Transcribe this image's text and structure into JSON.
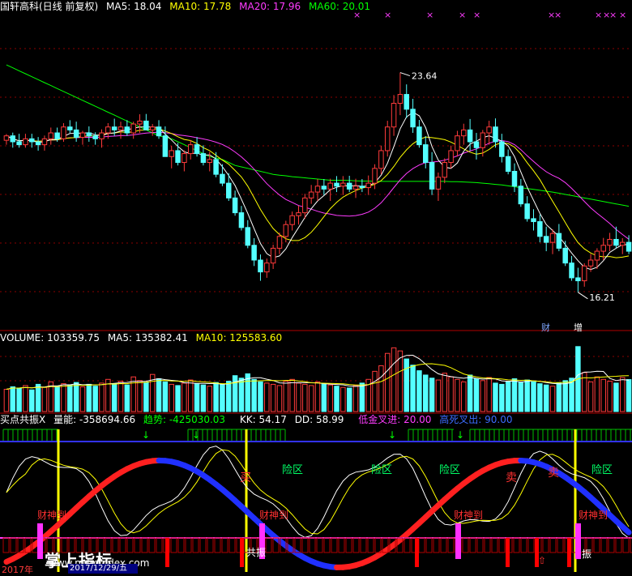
{
  "colors": {
    "up": "#ff3b3b",
    "down": "#54ffff",
    "ma5": "#ffffff",
    "ma10": "#ffff00",
    "ma20": "#ff3cff",
    "ma60": "#00ff00",
    "grid": "#8b0000",
    "blue_line": "#3232ff"
  },
  "header": {
    "stock": "国轩高科(日线 前复权)",
    "ma5": "MA5: 18.04",
    "ma10": "MA10: 17.78",
    "ma20": "MA20: 17.96",
    "ma60": "MA60: 20.01"
  },
  "volume_header": {
    "label": "VOLUME: 103359.75",
    "ma5": "MA5: 135382.41",
    "ma10": "MA10: 125583.60"
  },
  "indicator_header": {
    "name": "买点共振X",
    "liangneng": "量能: -358694.66",
    "qushi": "趋势: -425030.03",
    "kk": "KK: 54.17",
    "dd": "DD: 58.99",
    "dijin": "低金叉进: 20.00",
    "gaosi": "高死叉出: 90.00"
  },
  "price_labels": {
    "high": "23.64",
    "low": "16.21",
    "cai": "财",
    "zeng": "增"
  },
  "annotations": {
    "danger": "险区",
    "danger2": "险区",
    "danger3": "险区",
    "danger4": "险区",
    "caishen": "财神到",
    "buy": "买",
    "sell": "卖",
    "gongzhen": "共振",
    "zhen": "振",
    "buy_arrow": "⇧"
  },
  "watermark": "掌上指标",
  "watermark_url": "www.palmindex.com",
  "bottom": {
    "year": "2017年",
    "date": "2017/12/29/五"
  },
  "chart_data": [
    {
      "type": "candlestick",
      "title": "国轩高科(日线 前复权)",
      "ylim": [
        15.0,
        25.6
      ],
      "annotated_high": 23.64,
      "annotated_low": 16.21,
      "candles": [
        [
          21.35,
          21.56,
          21.2,
          21.5
        ],
        [
          21.5,
          21.61,
          21.1,
          21.3
        ],
        [
          21.3,
          21.57,
          21.1,
          21.2
        ],
        [
          21.2,
          21.57,
          21.1,
          21.4
        ],
        [
          21.4,
          21.57,
          21.1,
          21.3
        ],
        [
          21.3,
          21.46,
          21.0,
          21.2
        ],
        [
          21.2,
          21.51,
          21.0,
          21.4
        ],
        [
          21.4,
          21.78,
          21.2,
          21.6
        ],
        [
          21.6,
          21.78,
          21.3,
          21.4
        ],
        [
          21.4,
          21.93,
          21.3,
          21.8
        ],
        [
          21.8,
          22.03,
          21.6,
          21.7
        ],
        [
          21.7,
          21.98,
          21.3,
          21.45
        ],
        [
          21.45,
          21.67,
          21.2,
          21.6
        ],
        [
          21.6,
          21.82,
          21.3,
          21.5
        ],
        [
          21.5,
          21.62,
          21.2,
          21.4
        ],
        [
          21.4,
          21.72,
          21.1,
          21.6
        ],
        [
          21.6,
          21.93,
          21.4,
          21.8
        ],
        [
          21.8,
          22.08,
          21.5,
          21.7
        ],
        [
          21.7,
          21.98,
          21.4,
          21.8
        ],
        [
          21.8,
          22.03,
          21.5,
          21.6
        ],
        [
          21.6,
          21.98,
          21.4,
          21.9
        ],
        [
          21.9,
          22.23,
          21.6,
          22.0
        ],
        [
          22.0,
          22.24,
          21.7,
          21.7
        ],
        [
          21.7,
          21.9,
          21.5,
          21.8
        ],
        [
          21.8,
          22.03,
          21.4,
          21.5
        ],
        [
          21.5,
          21.82,
          21.0,
          20.8
        ],
        [
          20.8,
          21.16,
          20.4,
          21.0
        ],
        [
          21.0,
          21.26,
          20.5,
          20.6
        ],
        [
          20.6,
          21.01,
          20.3,
          20.9
        ],
        [
          20.9,
          21.36,
          20.7,
          21.2
        ],
        [
          21.2,
          21.46,
          20.8,
          20.9
        ],
        [
          20.9,
          21.18,
          20.5,
          20.6
        ],
        [
          20.6,
          20.96,
          20.3,
          20.7
        ],
        [
          20.7,
          20.95,
          20.1,
          20.2
        ],
        [
          20.2,
          20.54,
          19.8,
          19.9
        ],
        [
          19.9,
          20.24,
          19.3,
          19.4
        ],
        [
          19.4,
          19.65,
          18.8,
          18.9
        ],
        [
          18.9,
          19.13,
          18.3,
          18.4
        ],
        [
          18.4,
          18.65,
          17.7,
          17.8
        ],
        [
          17.8,
          18.04,
          17.1,
          17.3
        ],
        [
          17.3,
          17.49,
          16.6,
          16.9
        ],
        [
          16.9,
          17.35,
          16.7,
          17.2
        ],
        [
          17.2,
          17.82,
          17.0,
          17.7
        ],
        [
          17.7,
          18.23,
          17.5,
          18.1
        ],
        [
          18.1,
          18.63,
          17.9,
          18.5
        ],
        [
          18.5,
          18.94,
          18.3,
          18.8
        ],
        [
          18.8,
          19.14,
          18.5,
          18.9
        ],
        [
          18.9,
          19.54,
          18.7,
          19.4
        ],
        [
          19.4,
          19.84,
          19.2,
          19.6
        ],
        [
          19.6,
          20.04,
          19.3,
          19.8
        ],
        [
          19.8,
          20.04,
          19.5,
          19.7
        ],
        [
          19.7,
          20.05,
          19.3,
          19.9
        ],
        [
          19.9,
          20.14,
          19.6,
          19.8
        ],
        [
          19.8,
          20.14,
          19.5,
          19.9
        ],
        [
          19.9,
          20.15,
          19.6,
          19.7
        ],
        [
          19.7,
          20.05,
          19.4,
          19.8
        ],
        [
          19.8,
          20.04,
          19.6,
          19.75
        ],
        [
          19.75,
          20.16,
          19.5,
          19.9
        ],
        [
          19.9,
          20.54,
          19.7,
          20.4
        ],
        [
          20.4,
          21.17,
          20.2,
          21.0
        ],
        [
          21.0,
          22.01,
          20.8,
          21.8
        ],
        [
          21.8,
          22.88,
          21.5,
          22.6
        ],
        [
          22.6,
          23.64,
          22.2,
          22.9
        ],
        [
          22.9,
          23.24,
          22.1,
          22.4
        ],
        [
          22.4,
          22.75,
          21.6,
          21.8
        ],
        [
          21.8,
          22.04,
          21.1,
          21.2
        ],
        [
          21.2,
          21.49,
          20.4,
          20.6
        ],
        [
          20.6,
          20.95,
          19.5,
          19.7
        ],
        [
          19.7,
          20.26,
          19.3,
          20.1
        ],
        [
          20.1,
          20.74,
          19.9,
          20.6
        ],
        [
          20.6,
          21.17,
          20.4,
          21.0
        ],
        [
          21.0,
          21.67,
          20.8,
          21.5
        ],
        [
          21.5,
          21.91,
          21.2,
          21.7
        ],
        [
          21.7,
          22.07,
          21.0,
          21.3
        ],
        [
          21.3,
          21.6,
          20.7,
          21.1
        ],
        [
          21.1,
          21.7,
          20.8,
          21.6
        ],
        [
          21.6,
          22.01,
          21.2,
          21.8
        ],
        [
          21.8,
          22.09,
          21.1,
          21.3
        ],
        [
          21.3,
          21.57,
          20.6,
          20.8
        ],
        [
          20.8,
          21.04,
          20.2,
          20.3
        ],
        [
          20.3,
          20.57,
          19.6,
          19.8
        ],
        [
          19.8,
          20.04,
          19.1,
          19.2
        ],
        [
          19.2,
          19.46,
          18.6,
          18.7
        ],
        [
          18.7,
          19.02,
          18.3,
          18.6
        ],
        [
          18.6,
          18.84,
          17.9,
          18.1
        ],
        [
          18.1,
          18.43,
          17.6,
          17.9
        ],
        [
          17.9,
          18.34,
          17.5,
          18.2
        ],
        [
          18.2,
          18.52,
          17.6,
          17.7
        ],
        [
          17.7,
          17.95,
          17.1,
          17.2
        ],
        [
          17.2,
          17.44,
          16.6,
          16.7
        ],
        [
          16.7,
          17.04,
          16.21,
          16.6
        ],
        [
          16.6,
          17.19,
          16.4,
          17.1
        ],
        [
          17.1,
          17.51,
          16.9,
          17.3
        ],
        [
          17.3,
          17.7,
          17.0,
          17.6
        ],
        [
          17.6,
          18.05,
          17.3,
          17.8
        ],
        [
          17.8,
          18.22,
          17.6,
          18.0
        ],
        [
          18.0,
          18.43,
          17.7,
          17.8
        ],
        [
          17.8,
          18.04,
          17.5,
          17.9
        ],
        [
          17.9,
          18.14,
          17.5,
          17.6
        ]
      ],
      "ma60": [
        23.9,
        23.8,
        23.7,
        23.6,
        23.5,
        23.4,
        23.3,
        23.2,
        23.1,
        23.0,
        22.9,
        22.8,
        22.7,
        22.6,
        22.5,
        22.4,
        22.3,
        22.2,
        22.1,
        22.0,
        21.9,
        21.8,
        21.7,
        21.6,
        21.5,
        21.45,
        21.4,
        21.3,
        21.2,
        21.1,
        21.0,
        20.9,
        20.8,
        20.75,
        20.7,
        20.6,
        20.5,
        20.45,
        20.4,
        20.35,
        20.3,
        20.25,
        20.2,
        20.17,
        20.15,
        20.12,
        20.1,
        20.08,
        20.06,
        20.04,
        20.02,
        20.0,
        20.0,
        20.0,
        19.99,
        19.98,
        19.97,
        19.97,
        19.96,
        19.96,
        19.96,
        19.96,
        19.96,
        19.96,
        19.96,
        19.96,
        19.96,
        19.96,
        19.96,
        19.96,
        19.95,
        19.95,
        19.94,
        19.93,
        19.92,
        19.9,
        19.88,
        19.86,
        19.84,
        19.81,
        19.78,
        19.75,
        19.72,
        19.69,
        19.66,
        19.63,
        19.6,
        19.56,
        19.52,
        19.48,
        19.44,
        19.4,
        19.36,
        19.32,
        19.28,
        19.24,
        19.2,
        19.16,
        19.12
      ]
    },
    {
      "type": "bar",
      "title": "VOLUME",
      "ylim": [
        0,
        220000
      ],
      "series": [
        {
          "name": "VOLUME",
          "values": [
            72000,
            80000,
            76000,
            84000,
            70000,
            88000,
            78000,
            96000,
            82000,
            90000,
            86000,
            94000,
            80000,
            88000,
            82000,
            92000,
            104000,
            90000,
            98000,
            86000,
            112000,
            100000,
            94000,
            120000,
            106000,
            96000,
            88000,
            84000,
            92000,
            102000,
            90000,
            86000,
            82000,
            94000,
            88000,
            98000,
            116000,
            108000,
            122000,
            104000,
            96000,
            92000,
            88000,
            84000,
            98000,
            104000,
            92000,
            88000,
            84000,
            96000,
            90000,
            86000,
            82000,
            78000,
            76000,
            84000,
            92000,
            104000,
            130000,
            148000,
            188000,
            206000,
            196000,
            170000,
            150000,
            132000,
            118000,
            108000,
            102000,
            124000,
            112000,
            104000,
            96000,
            118000,
            106000,
            100000,
            110000,
            92000,
            88000,
            98000,
            106000,
            94000,
            102000,
            96000,
            90000,
            86000,
            82000,
            92000,
            100000,
            108000,
            210000,
            126000,
            96000,
            112000,
            104000,
            98000,
            92000,
            110000,
            103360
          ]
        }
      ]
    }
  ]
}
